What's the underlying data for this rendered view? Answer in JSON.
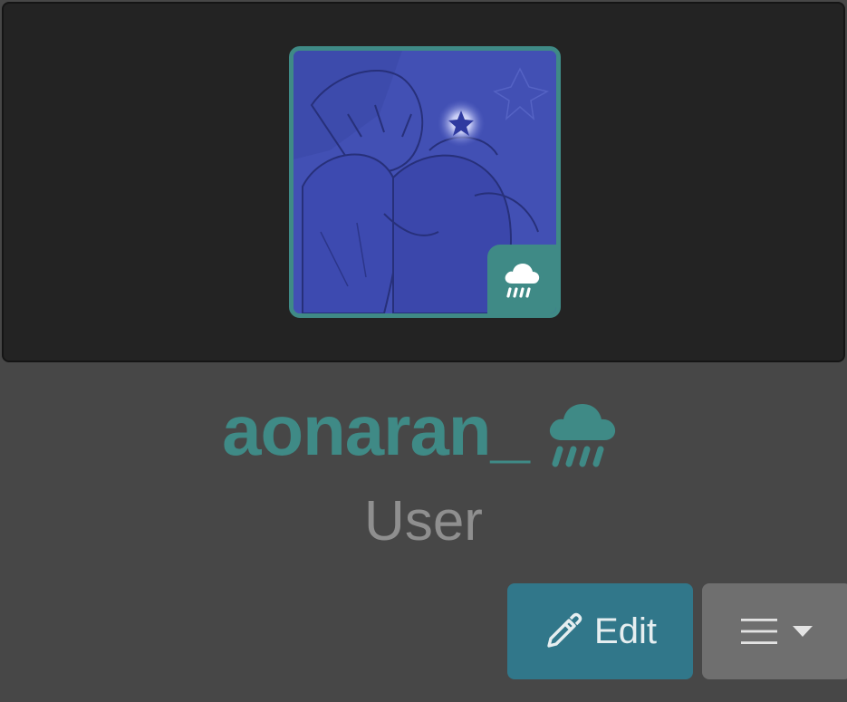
{
  "profile": {
    "username": "aonaran_",
    "role": "User",
    "accent_color": "#3f8a86",
    "status_icon": "cloud-rain-icon",
    "avatar": {
      "description_icon": "avatar-image",
      "badge_icon": "cloud-rain-icon"
    }
  },
  "actions": {
    "edit_label": "Edit",
    "edit_icon": "pencil-icon",
    "menu_icon": "hamburger-icon",
    "menu_caret_icon": "caret-down-icon"
  },
  "colors": {
    "page_bg": "#474747",
    "banner_bg": "#232323",
    "edit_button_bg": "#31778a",
    "menu_button_bg": "#6f6f6f",
    "role_text": "#8f8f8f"
  }
}
